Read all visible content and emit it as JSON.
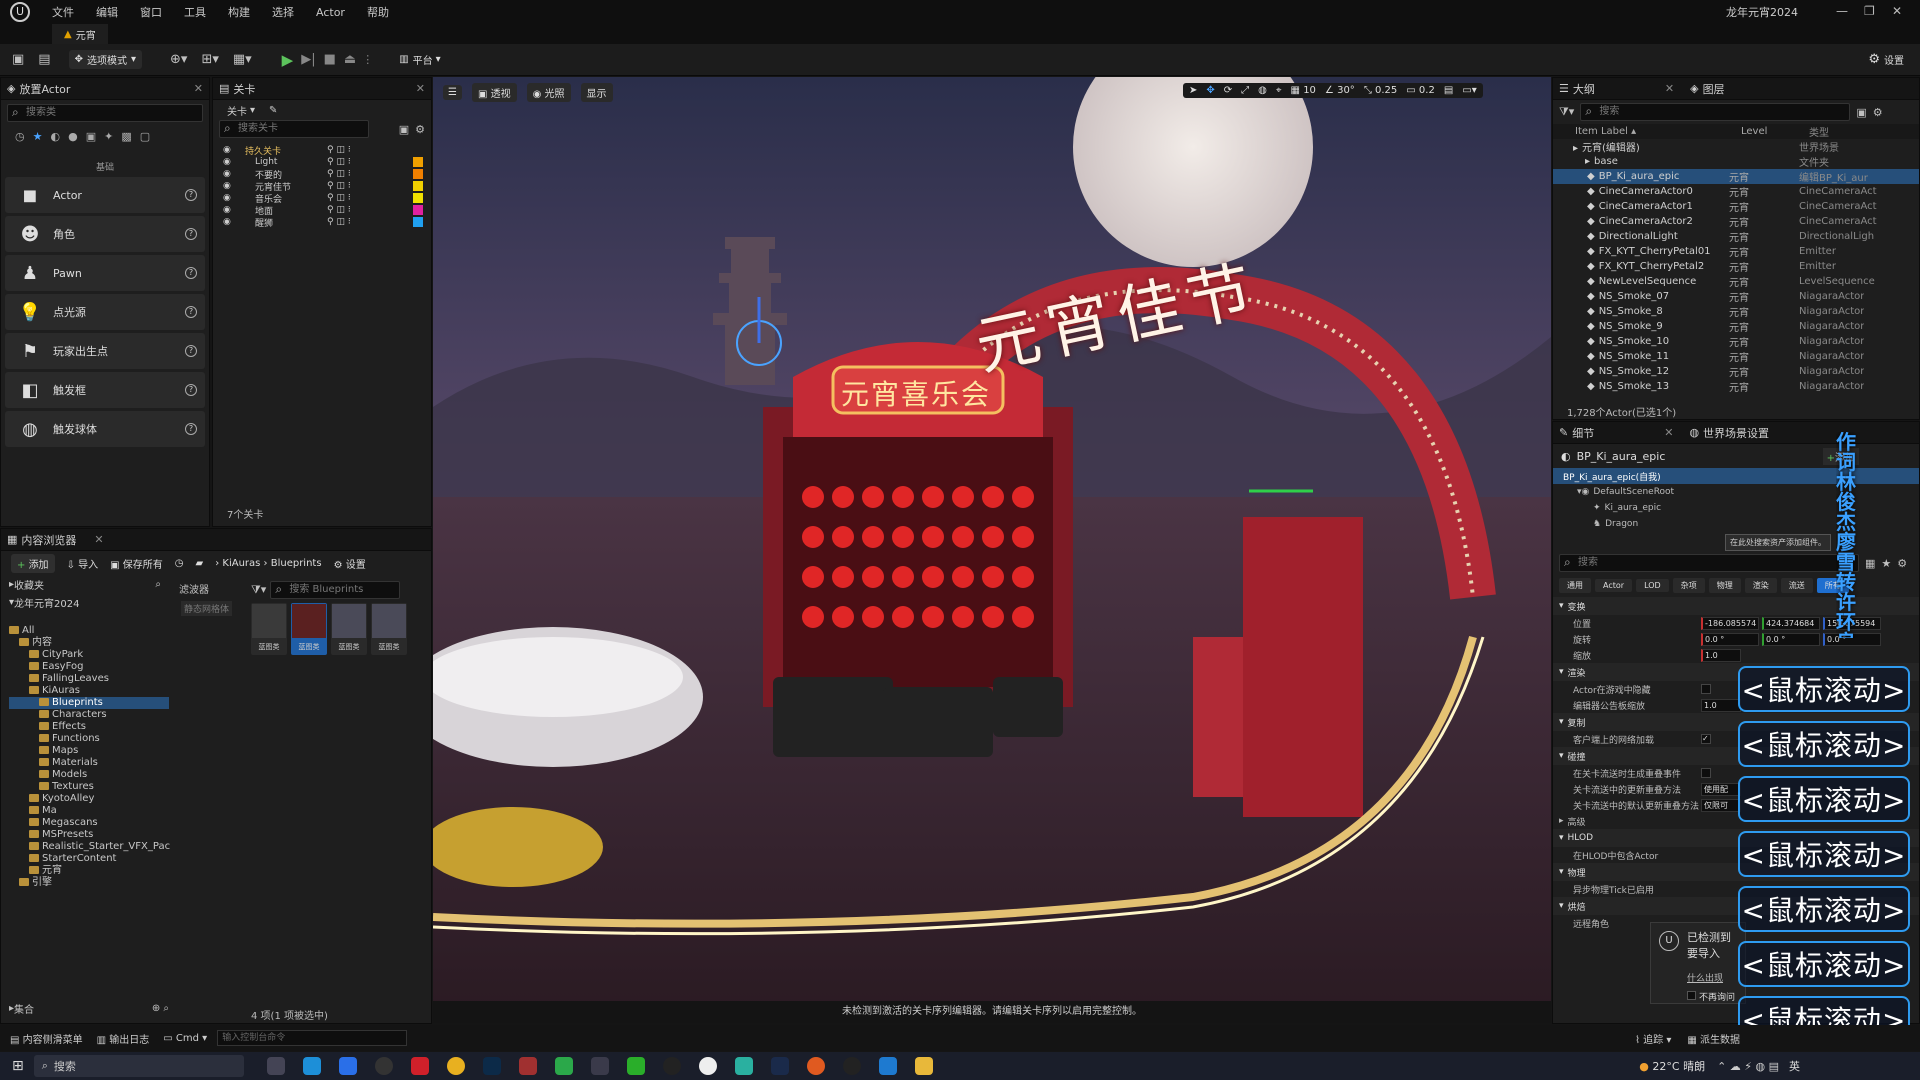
{
  "menu": [
    "文件",
    "编辑",
    "窗口",
    "工具",
    "构建",
    "选择",
    "Actor",
    "帮助"
  ],
  "project_name": "龙年元宵2024",
  "level_tab": "元宵",
  "toolbar": {
    "mode": "选项模式",
    "platform": "平台",
    "settings": "设置"
  },
  "place_actors": {
    "title": "放置Actor",
    "search": "搜索类",
    "category": "基础",
    "items": [
      {
        "label": "Actor",
        "icon": "cube-icon"
      },
      {
        "label": "角色",
        "icon": "character-icon"
      },
      {
        "label": "Pawn",
        "icon": "pawn-icon"
      },
      {
        "label": "点光源",
        "icon": "point-light-icon"
      },
      {
        "label": "玩家出生点",
        "icon": "player-start-icon"
      },
      {
        "label": "触发框",
        "icon": "trigger-box-icon"
      },
      {
        "label": "触发球体",
        "icon": "trigger-sphere-icon"
      }
    ]
  },
  "levels": {
    "title": "关卡",
    "dropdown": "关卡",
    "search": "搜索关卡",
    "rows": [
      {
        "name": "持久关卡",
        "color": ""
      },
      {
        "name": "Light",
        "color": "#f0a000"
      },
      {
        "name": "不要的",
        "color": "#f08000"
      },
      {
        "name": "元宵佳节",
        "color": "#f0d000"
      },
      {
        "name": "音乐会",
        "color": "#f0e000"
      },
      {
        "name": "地面",
        "color": "#e020a0"
      },
      {
        "name": "醒狮",
        "color": "#20a0f0"
      }
    ],
    "count": "7个关卡"
  },
  "content_browser": {
    "title": "内容浏览器",
    "add": "添加",
    "import": "导入",
    "save_all": "保存所有",
    "path": [
      "KiAuras",
      "Blueprints"
    ],
    "settings": "设置",
    "favorites": "收藏夹",
    "project": "龙年元宵2024",
    "filters": "滤波器",
    "filter_hint": "静态网格体",
    "search": "搜索 Blueprints",
    "collections": "集合",
    "status": "4 项(1 项被选中)",
    "tree": [
      "All",
      "内容",
      "CityPark",
      "EasyFog",
      "FallingLeaves",
      "KiAuras",
      "Blueprints",
      "Characters",
      "Effects",
      "Functions",
      "Maps",
      "Materials",
      "Models",
      "Textures",
      "KyotoAlley",
      "Ma",
      "Megascans",
      "MSPresets",
      "Realistic_Starter_VFX_Pac",
      "StarterContent",
      "元宵",
      "引擎"
    ],
    "assets": [
      "蓝图类",
      "蓝图类",
      "蓝图类",
      "蓝图类"
    ]
  },
  "viewport": {
    "perspective": "透视",
    "lit": "光照",
    "show": "显示",
    "grid": "10",
    "angle": "30°",
    "scale": "0.25",
    "camspeed": "0.2",
    "message": "未检测到激活的关卡序列编辑器。请编辑关卡序列以启用完整控制。",
    "sign_top": "元宵佳节",
    "sign_gate": "元宵喜乐会"
  },
  "outliner": {
    "title": "大纲",
    "layers": "图层",
    "search": "搜索",
    "col_label": "Item Label",
    "col_level": "Level",
    "col_type": "类型",
    "count": "1,728个Actor(已选1个)",
    "rows": [
      {
        "label": "元宵(编辑器)",
        "level": "",
        "type": "世界场景"
      },
      {
        "label": "base",
        "level": "",
        "type": "文件夹"
      },
      {
        "label": "BP_Ki_aura_epic",
        "level": "元宵",
        "type": "编辑BP_Ki_aur"
      },
      {
        "label": "CineCameraActor0",
        "level": "元宵",
        "type": "CineCameraAct"
      },
      {
        "label": "CineCameraActor1",
        "level": "元宵",
        "type": "CineCameraAct"
      },
      {
        "label": "CineCameraActor2",
        "level": "元宵",
        "type": "CineCameraAct"
      },
      {
        "label": "DirectionalLight",
        "level": "元宵",
        "type": "DirectionalLigh"
      },
      {
        "label": "FX_KYT_CherryPetal01",
        "level": "元宵",
        "type": "Emitter"
      },
      {
        "label": "FX_KYT_CherryPetal2",
        "level": "元宵",
        "type": "Emitter"
      },
      {
        "label": "NewLevelSequence",
        "level": "元宵",
        "type": "LevelSequence"
      },
      {
        "label": "NS_Smoke_07",
        "level": "元宵",
        "type": "NiagaraActor"
      },
      {
        "label": "NS_Smoke_8",
        "level": "元宵",
        "type": "NiagaraActor"
      },
      {
        "label": "NS_Smoke_9",
        "level": "元宵",
        "type": "NiagaraActor"
      },
      {
        "label": "NS_Smoke_10",
        "level": "元宵",
        "type": "NiagaraActor"
      },
      {
        "label": "NS_Smoke_11",
        "level": "元宵",
        "type": "NiagaraActor"
      },
      {
        "label": "NS_Smoke_12",
        "level": "元宵",
        "type": "NiagaraActor"
      },
      {
        "label": "NS_Smoke_13",
        "level": "元宵",
        "type": "NiagaraActor"
      }
    ]
  },
  "details": {
    "title": "细节",
    "world_settings": "世界场景设置",
    "actor": "BP_Ki_aura_epic",
    "add": "添加",
    "self": "BP_Ki_aura_epic(自我)",
    "components": [
      "DefaultSceneRoot",
      "Ki_aura_epic",
      "Dragon"
    ],
    "tooltip": "在此处搜索资产添加组件。",
    "search": "搜索",
    "filters": [
      "通用",
      "Actor",
      "LOD",
      "杂项",
      "物理",
      "渲染",
      "流送",
      "所有"
    ],
    "transform": "变换",
    "location_label": "位置",
    "rotation_label": "旋转",
    "scale_label": "缩放",
    "loc": [
      "-186.085574",
      "424.374684",
      "150.075594"
    ],
    "rot": [
      "0.0 °",
      "0.0 °",
      "0.0 °"
    ],
    "scl": "1.0",
    "rendering": "渲染",
    "hidden_in_game": "Actor在游戏中隐藏",
    "billboard": "编辑器公告板缩放",
    "billboard_val": "1.0",
    "replication": "复制",
    "net_load": "客户端上的网络加载",
    "collision": "碰撞",
    "gen_overlap": "在关卡流送时生成重叠事件",
    "update_overlap": "关卡流送中的更新重叠方法",
    "update_overlap_val": "使用配",
    "default_overlap": "关卡流送中的默认更新重叠方法",
    "default_overlap_val": "仅限可",
    "advanced": "高级",
    "hlod": "HLOD",
    "include_hlod": "在HLOD中包含Actor",
    "physics": "物理",
    "async_tick": "异步物理Tick已启用",
    "cooking": "烘焙",
    "remote_role": "远程角色"
  },
  "notify": {
    "text1": "已检测到",
    "text2": "要导入",
    "link": "什么出现",
    "dont": "不再询问"
  },
  "overlay": {
    "mouse": "<鼠标滚动>",
    "credits": "作词 林俊杰 廖雪转 许环良"
  },
  "statusbar": {
    "drawer": "内容侧滑菜单",
    "output": "输出日志",
    "cmd": "Cmd",
    "console": "输入控制台命令",
    "trace": "追踪",
    "derived": "派生数据"
  },
  "taskbar": {
    "search": "搜索",
    "weather": "22°C 晴朗",
    "lang": "英"
  }
}
